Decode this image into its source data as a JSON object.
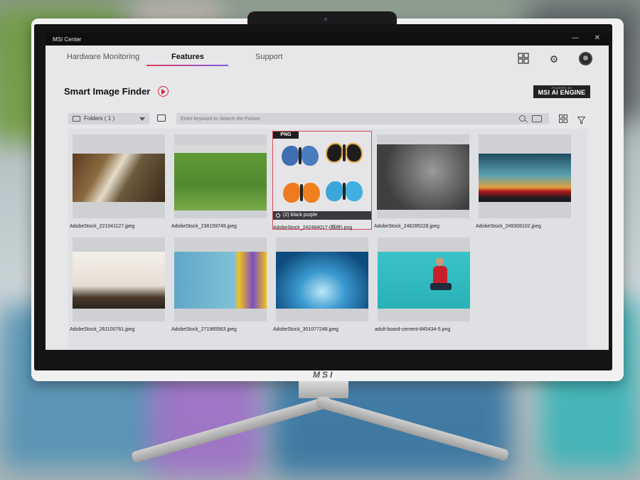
{
  "window": {
    "title": "MSI Center",
    "minimize": "—",
    "close": "✕"
  },
  "brand": "MSI",
  "nav": {
    "tabs": [
      {
        "label": "Hardware Monitoring"
      },
      {
        "label": "Features"
      },
      {
        "label": "Support"
      }
    ],
    "active": "Features"
  },
  "header": {
    "title": "Smart Image Finder",
    "badge_small": "POWERED BY",
    "badge": "MSI AI ENGINE"
  },
  "toolbar": {
    "folders_label": "Folders ( 1 )",
    "search_placeholder": "Enter keyword to Search the Picture"
  },
  "images": [
    {
      "file": "AdobeStock_221041127.jpeg"
    },
    {
      "file": "AdobeStock_238159749.jpeg"
    },
    {
      "file": "AdobeStock_242484017-(精修).png",
      "type_tag": "PNG",
      "tags": "(2) black  purple",
      "selected": true
    },
    {
      "file": "AdobeStock_248285228.jpeg"
    },
    {
      "file": "AdobeStock_249308102.jpeg"
    },
    {
      "file": "AdobeStock_261100761.jpeg"
    },
    {
      "file": "AdobeStock_271965563.jpeg"
    },
    {
      "file": "AdobeStock_301077248.jpeg"
    },
    {
      "file": "adult-board-cement-845434-5.png"
    }
  ],
  "colors": {
    "accent_red": "#d12a3e",
    "accent_gradient_end": "#7b5ce6",
    "titlebar": "#0f0f10"
  },
  "icons": [
    "search-icon",
    "image-search-icon",
    "grid-view-icon",
    "filter-icon",
    "gear-icon",
    "apps-grid-icon",
    "folder-icon",
    "add-folder-icon",
    "play-icon",
    "tag-icon"
  ]
}
